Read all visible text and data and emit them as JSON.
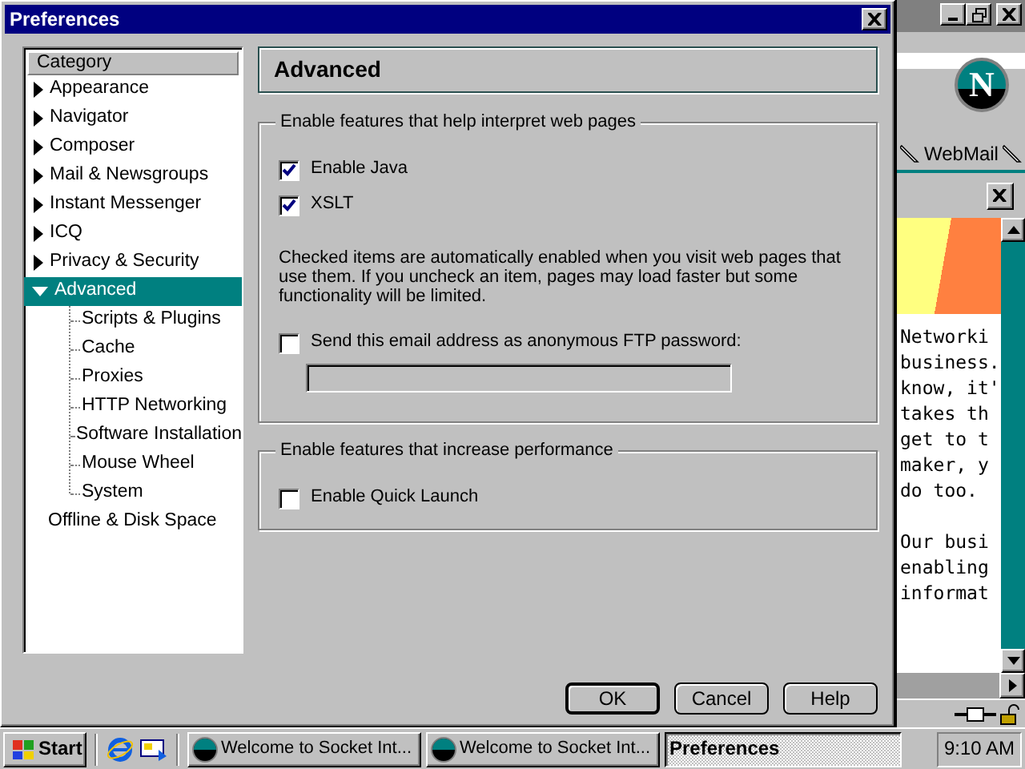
{
  "dialog": {
    "title": "Preferences"
  },
  "category_tree": {
    "header": "Category",
    "items": [
      {
        "label": "Appearance",
        "kind": "branch",
        "expanded": false,
        "selected": false
      },
      {
        "label": "Navigator",
        "kind": "branch",
        "expanded": false,
        "selected": false
      },
      {
        "label": "Composer",
        "kind": "branch",
        "expanded": false,
        "selected": false
      },
      {
        "label": "Mail & Newsgroups",
        "kind": "branch",
        "expanded": false,
        "selected": false
      },
      {
        "label": "Instant Messenger",
        "kind": "branch",
        "expanded": false,
        "selected": false
      },
      {
        "label": "ICQ",
        "kind": "branch",
        "expanded": false,
        "selected": false
      },
      {
        "label": "Privacy & Security",
        "kind": "branch",
        "expanded": false,
        "selected": false
      },
      {
        "label": "Advanced",
        "kind": "branch",
        "expanded": true,
        "selected": true,
        "children": [
          {
            "label": "Scripts & Plugins",
            "selected": false
          },
          {
            "label": "Cache",
            "selected": false
          },
          {
            "label": "Proxies",
            "selected": false
          },
          {
            "label": "HTTP Networking",
            "selected": false
          },
          {
            "label": "Software Installation",
            "selected": false
          },
          {
            "label": "Mouse Wheel",
            "selected": false
          },
          {
            "label": "System",
            "selected": false
          }
        ]
      },
      {
        "label": "Offline & Disk Space",
        "kind": "leaf",
        "selected": false
      }
    ]
  },
  "panel": {
    "title": "Advanced",
    "groups": [
      {
        "legend": "Enable features that help interpret web pages",
        "items": [
          {
            "kind": "checkbox",
            "label": "Enable Java",
            "checked": true
          },
          {
            "kind": "checkbox",
            "label": "XSLT",
            "checked": true
          },
          {
            "kind": "note",
            "text": "Checked items are automatically enabled when you visit web pages that use them. If you uncheck an item, pages may load faster but some functionality will be limited."
          },
          {
            "kind": "checkbox",
            "label": "Send this email address as anonymous FTP password:",
            "checked": false
          },
          {
            "kind": "field",
            "disabled": true
          }
        ]
      },
      {
        "legend": "Enable features that increase performance",
        "items": [
          {
            "kind": "checkbox",
            "label": "Enable Quick Launch",
            "checked": false
          }
        ]
      }
    ]
  },
  "buttons": [
    {
      "label": "OK",
      "default": true
    },
    {
      "label": "Cancel",
      "default": false
    },
    {
      "label": "Help",
      "default": false
    }
  ],
  "background_window": {
    "logo": "N",
    "link": "WebMail",
    "paragraphs": [
      [
        "Networki",
        "business.",
        "know, it'",
        "takes th",
        "get to t",
        "maker, y",
        "do too."
      ],
      [
        "Our busi",
        "enabling",
        "informat"
      ]
    ]
  },
  "taskbar": {
    "start": "Start",
    "tasks": [
      {
        "label": "Welcome to Socket Int...",
        "selected": false
      },
      {
        "label": "Welcome to Socket Int...",
        "selected": false
      },
      {
        "label": "Preferences",
        "selected": true
      }
    ],
    "clock": "9:10 AM"
  }
}
